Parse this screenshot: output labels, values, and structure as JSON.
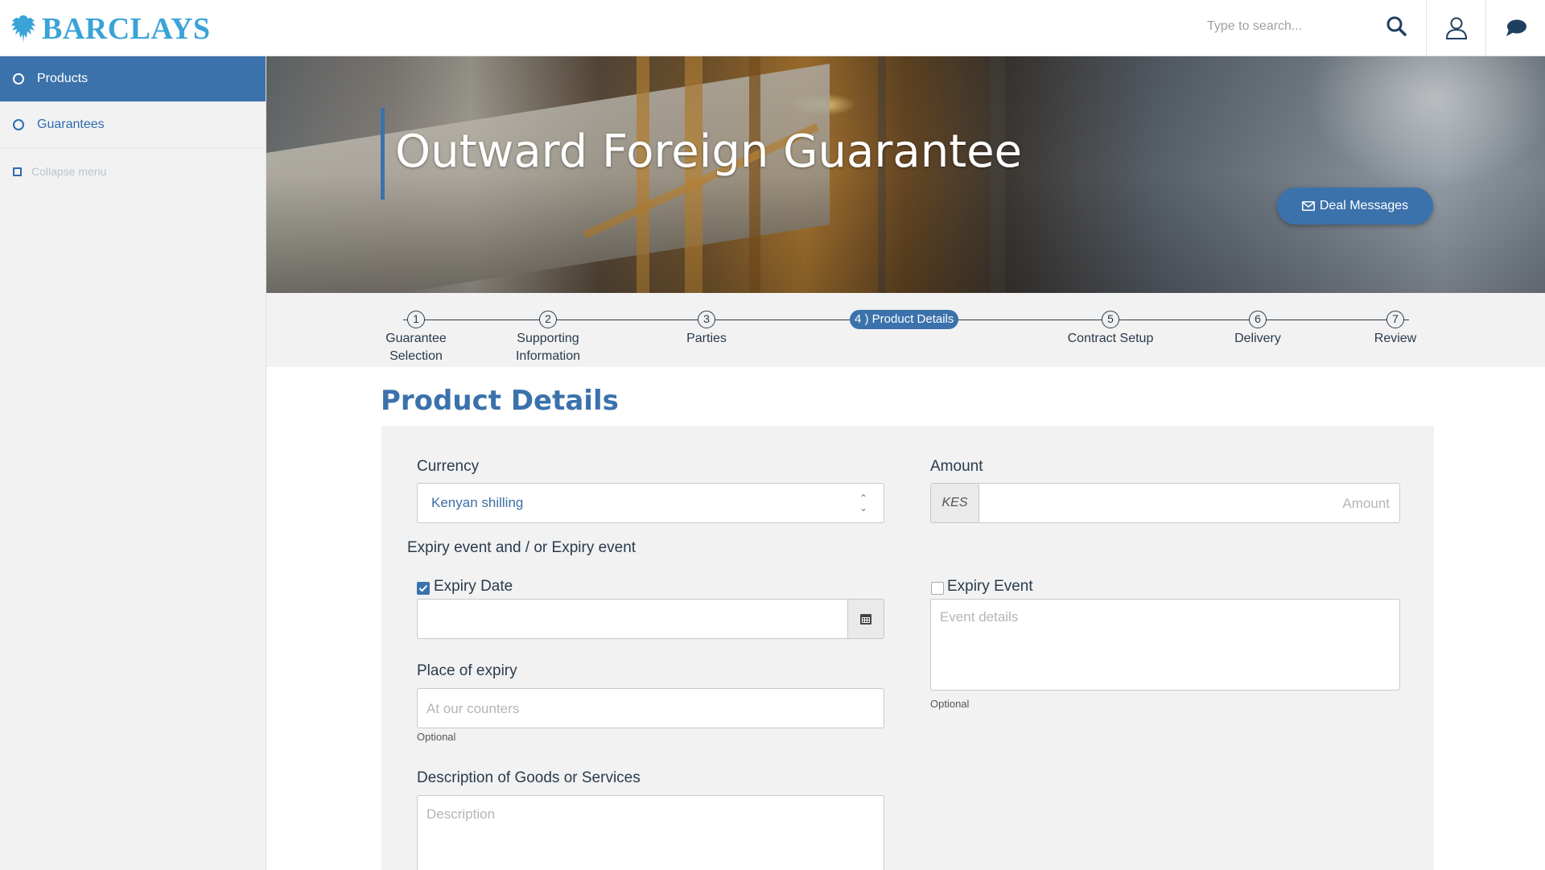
{
  "brand": {
    "name": "BARCLAYS",
    "color": "#3aa3d8"
  },
  "header": {
    "search_placeholder": "Type to search...",
    "icons": [
      "search-icon",
      "user-icon",
      "chat-icon"
    ]
  },
  "sidebar": {
    "items": [
      {
        "label": "Products",
        "active": true
      },
      {
        "label": "Guarantees",
        "active": false
      }
    ],
    "collapse_label": "Collapse menu"
  },
  "hero": {
    "title": "Outward Foreign Guarantee",
    "deal_messages_label": "Deal Messages"
  },
  "stepper": {
    "steps": [
      {
        "num": "1",
        "line1": "Guarantee",
        "line2": "Selection"
      },
      {
        "num": "2",
        "line1": "Supporting",
        "line2": "Information"
      },
      {
        "num": "3",
        "line1": "Parties",
        "line2": ""
      },
      {
        "num": "4",
        "label": "4 ) Product Details",
        "active": true
      },
      {
        "num": "5",
        "line1": "Contract Setup",
        "line2": ""
      },
      {
        "num": "6",
        "line1": "Delivery",
        "line2": ""
      },
      {
        "num": "7",
        "line1": "Review",
        "line2": ""
      }
    ]
  },
  "form": {
    "title": "Product Details",
    "currency": {
      "label": "Currency",
      "value": "Kenyan shilling"
    },
    "amount": {
      "label": "Amount",
      "currency_code": "KES",
      "placeholder": "Amount"
    },
    "expiry_section_label": "Expiry event and / or Expiry event",
    "expiry_date": {
      "label": "Expiry Date",
      "checked": true,
      "value": ""
    },
    "expiry_event": {
      "label": "Expiry Event",
      "checked": false,
      "placeholder": "Event details",
      "hint": "Optional"
    },
    "place_of_expiry": {
      "label": "Place of expiry",
      "placeholder": "At our counters",
      "hint": "Optional"
    },
    "description": {
      "label": "Description of Goods or Services",
      "placeholder": "Description"
    }
  },
  "colors": {
    "primary": "#3b72ac",
    "text": "#2a3b4c",
    "panel": "#f2f2f2"
  }
}
